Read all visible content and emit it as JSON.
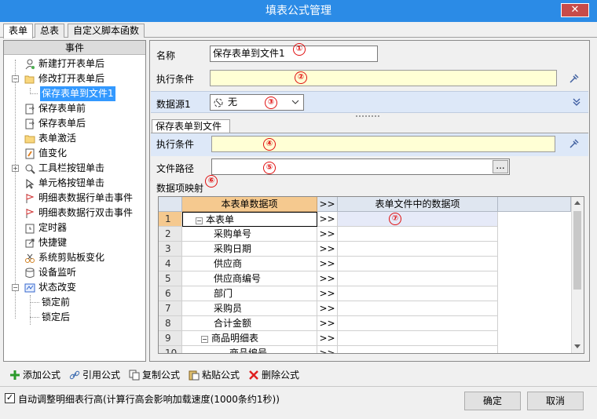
{
  "window": {
    "title": "填表公式管理",
    "close_symbol": "✕"
  },
  "top_tabs": [
    "表单",
    "总表",
    "自定义脚本函数"
  ],
  "left": {
    "header": "事件",
    "items": [
      "新建打开表单后",
      "修改打开表单后",
      "保存表单到文件1",
      "保存表单前",
      "保存表单后",
      "表单激活",
      "值变化",
      "工具栏按钮单击",
      "单元格按钮单击",
      "明细表数据行单击事件",
      "明细表数据行双击事件",
      "定时器",
      "快捷键",
      "系统剪贴板变化",
      "设备监听",
      "状态改变",
      "锁定前",
      "锁定后"
    ]
  },
  "form": {
    "name_label": "名称",
    "name_value": "保存表单到文件1",
    "cond_label": "执行条件",
    "ds_label": "数据源1",
    "ds_value": "无",
    "section_tab": "保存表单到文件",
    "cond2_label": "执行条件",
    "path_label": "文件路径",
    "path_button": "...",
    "map_label": "数据项映射"
  },
  "markers": [
    "①",
    "②",
    "③",
    "④",
    "⑤",
    "⑥",
    "⑦"
  ],
  "grid": {
    "headers": [
      "本表单数据项",
      ">>",
      "表单文件中的数据项"
    ],
    "rows": [
      {
        "num": "1",
        "item": "本表单",
        "arrow": ">>"
      },
      {
        "num": "2",
        "item": "采购单号",
        "arrow": ">>"
      },
      {
        "num": "3",
        "item": "采购日期",
        "arrow": ">>"
      },
      {
        "num": "4",
        "item": "供应商",
        "arrow": ">>"
      },
      {
        "num": "5",
        "item": "供应商编号",
        "arrow": ">>"
      },
      {
        "num": "6",
        "item": "部门",
        "arrow": ">>"
      },
      {
        "num": "7",
        "item": "采购员",
        "arrow": ">>"
      },
      {
        "num": "8",
        "item": "合计金额",
        "arrow": ">>"
      },
      {
        "num": "9",
        "item": "商品明细表",
        "arrow": ">>"
      },
      {
        "num": "10",
        "item": "商品编号",
        "arrow": ">>"
      }
    ]
  },
  "toolbar": {
    "add": "添加公式",
    "ref": "引用公式",
    "copy": "复制公式",
    "paste": "粘贴公式",
    "delete": "删除公式"
  },
  "footer": {
    "auto_adjust_label": "自动调整明细表行高(计算行高会影响加载速度(1000条约1秒))",
    "auto_adjust_checked": true,
    "ok": "确定",
    "cancel": "取消"
  },
  "colors": {
    "titlebar": "#2b8be6",
    "close": "#c74b4a",
    "selection": "#3399ff",
    "yellow_field": "#ffffd5",
    "marker": "#e01010"
  }
}
